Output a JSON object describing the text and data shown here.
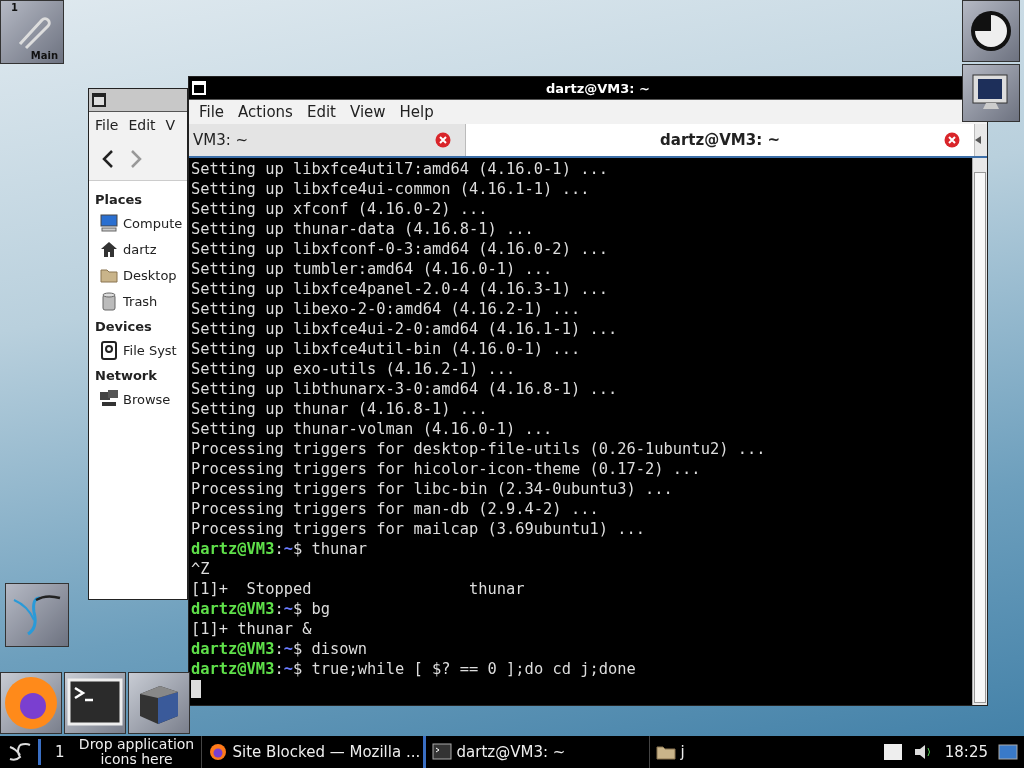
{
  "pager": {
    "number": "1",
    "label": "Main"
  },
  "file_manager": {
    "menu": [
      "File",
      "Edit",
      "V"
    ],
    "sidebar": [
      {
        "heading": "Places",
        "items": [
          {
            "label": "Compute",
            "kind": "computer"
          },
          {
            "label": "dartz",
            "kind": "home"
          },
          {
            "label": "Desktop",
            "kind": "folder"
          },
          {
            "label": "Trash",
            "kind": "trash"
          }
        ]
      },
      {
        "heading": "Devices",
        "items": [
          {
            "label": "File Syst",
            "kind": "drive"
          }
        ]
      },
      {
        "heading": "Network",
        "items": [
          {
            "label": "Browse",
            "kind": "network"
          }
        ]
      }
    ]
  },
  "terminal": {
    "title": "dartz@VM3: ~",
    "menu": [
      "File",
      "Actions",
      "Edit",
      "View",
      "Help"
    ],
    "tabs": [
      {
        "label": "VM3: ~",
        "selected": false
      },
      {
        "label": "dartz@VM3: ~",
        "selected": true
      }
    ],
    "lines": [
      {
        "kind": "output",
        "text": "Setting up libxfce4util7:amd64 (4.16.0-1) ..."
      },
      {
        "kind": "output",
        "text": "Setting up libxfce4ui-common (4.16.1-1) ..."
      },
      {
        "kind": "output",
        "text": "Setting up xfconf (4.16.0-2) ..."
      },
      {
        "kind": "output",
        "text": "Setting up thunar-data (4.16.8-1) ..."
      },
      {
        "kind": "output",
        "text": "Setting up libxfconf-0-3:amd64 (4.16.0-2) ..."
      },
      {
        "kind": "output",
        "text": "Setting up tumbler:amd64 (4.16.0-1) ..."
      },
      {
        "kind": "output",
        "text": "Setting up libxfce4panel-2.0-4 (4.16.3-1) ..."
      },
      {
        "kind": "output",
        "text": "Setting up libexo-2-0:amd64 (4.16.2-1) ..."
      },
      {
        "kind": "output",
        "text": "Setting up libxfce4ui-2-0:amd64 (4.16.1-1) ..."
      },
      {
        "kind": "output",
        "text": "Setting up libxfce4util-bin (4.16.0-1) ..."
      },
      {
        "kind": "output",
        "text": "Setting up exo-utils (4.16.2-1) ..."
      },
      {
        "kind": "output",
        "text": "Setting up libthunarx-3-0:amd64 (4.16.8-1) ..."
      },
      {
        "kind": "output",
        "text": "Setting up thunar (4.16.8-1) ..."
      },
      {
        "kind": "output",
        "text": "Setting up thunar-volman (4.16.0-1) ..."
      },
      {
        "kind": "output",
        "text": "Processing triggers for desktop-file-utils (0.26-1ubuntu2) ..."
      },
      {
        "kind": "output",
        "text": "Processing triggers for hicolor-icon-theme (0.17-2) ..."
      },
      {
        "kind": "output",
        "text": "Processing triggers for libc-bin (2.34-0ubuntu3) ..."
      },
      {
        "kind": "output",
        "text": "Processing triggers for man-db (2.9.4-2) ..."
      },
      {
        "kind": "output",
        "text": "Processing triggers for mailcap (3.69ubuntu1) ..."
      },
      {
        "kind": "prompt",
        "user": "dartz@VM3",
        "colon": ":",
        "path": "~",
        "rest": "$ thunar"
      },
      {
        "kind": "output",
        "text": "^Z"
      },
      {
        "kind": "output",
        "text": "[1]+  Stopped                 thunar"
      },
      {
        "kind": "prompt",
        "user": "dartz@VM3",
        "colon": ":",
        "path": "~",
        "rest": "$ bg"
      },
      {
        "kind": "output",
        "text": "[1]+ thunar &"
      },
      {
        "kind": "prompt",
        "user": "dartz@VM3",
        "colon": ":",
        "path": "~",
        "rest": "$ disown"
      },
      {
        "kind": "prompt",
        "user": "dartz@VM3",
        "colon": ":",
        "path": "~",
        "rest": "$ true;while [ $? == 0 ];do cd j;done"
      },
      {
        "kind": "cursor"
      }
    ]
  },
  "taskbar": {
    "workspace": "1",
    "launcher_hint": "Drop application icons here",
    "tasks": [
      {
        "label": "Site Blocked — Mozilla ...",
        "kind": "firefox"
      },
      {
        "label": "dartz@VM3: ~",
        "kind": "terminal"
      },
      {
        "label": "j",
        "kind": "folder"
      }
    ],
    "clock": "18:25"
  }
}
